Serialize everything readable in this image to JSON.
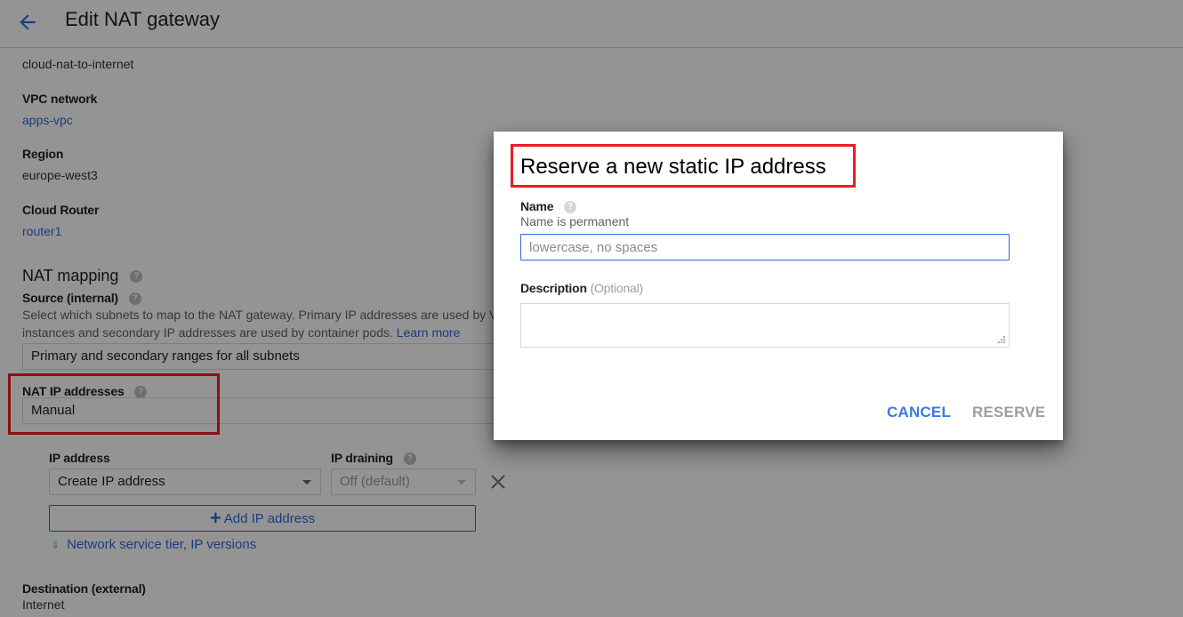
{
  "header": {
    "title": "Edit NAT gateway"
  },
  "gateway": {
    "name": "cloud-nat-to-internet",
    "vpc_label": "VPC network",
    "vpc_value": "apps-vpc",
    "region_label": "Region",
    "region_value": "europe-west3",
    "router_label": "Cloud Router",
    "router_value": "router1"
  },
  "nat_mapping": {
    "title": "NAT mapping",
    "source_label": "Source (internal)",
    "source_hint": "Select which subnets to map to the NAT gateway. Primary IP addresses are used by VM instances and secondary IP addresses are used by container pods.",
    "learn_more": "Learn more",
    "source_value": "Primary and secondary ranges for all subnets",
    "nat_ip_label": "NAT IP addresses",
    "nat_ip_value": "Manual",
    "ip_address_label": "IP address",
    "ip_address_value": "Create IP address",
    "ip_draining_label": "IP draining",
    "ip_draining_value": "Off (default)",
    "add_ip_label": "Add IP address",
    "expander_label": "Network service tier, IP versions",
    "destination_label": "Destination (external)",
    "destination_value": "Internet"
  },
  "dialog": {
    "title": "Reserve a new static IP address",
    "name_label": "Name",
    "name_sub": "Name is permanent",
    "name_placeholder": "lowercase, no spaces",
    "name_value": "",
    "description_label": "Description",
    "description_optional": "(Optional)",
    "description_value": "",
    "cancel_label": "CANCEL",
    "reserve_label": "RESERVE"
  },
  "icons": {
    "back": "arrow-left",
    "help": "?",
    "remove": "close-x",
    "add": "+",
    "expand": "double-chevron-down"
  },
  "colors": {
    "accent": "#3367d6",
    "primary_button": "#3b78e7",
    "disabled": "#9e9e9e",
    "highlight": "#ec1c24"
  }
}
